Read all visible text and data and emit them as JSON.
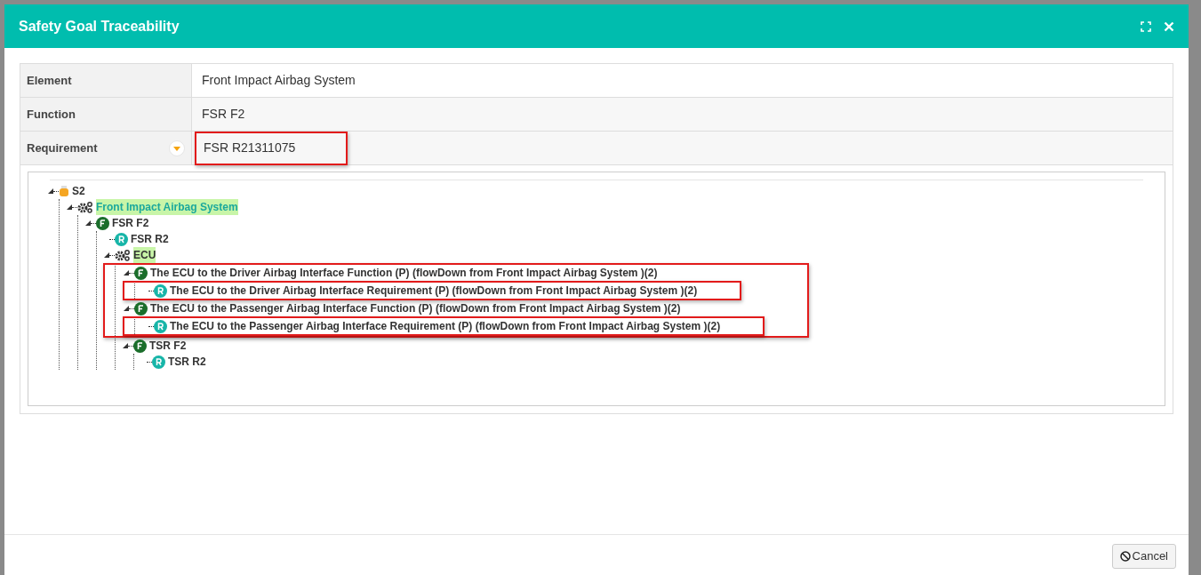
{
  "dialog": {
    "title": "Safety Goal Traceability"
  },
  "fields": [
    {
      "label": "Element",
      "value": "Front Impact Airbag System",
      "dropdown": false,
      "outlined": false
    },
    {
      "label": "Function",
      "value": "FSR F2",
      "dropdown": false,
      "outlined": false
    },
    {
      "label": "Requirement",
      "value": "FSR R21311075",
      "dropdown": true,
      "outlined": true
    }
  ],
  "tree": [
    {
      "kind": "goal",
      "label": "S2",
      "highlighted": false,
      "expanded": true,
      "children": [
        {
          "kind": "system",
          "label": "Front Impact Airbag System",
          "highlighted": true,
          "boxed": false,
          "expanded": true,
          "children": [
            {
              "kind": "function",
              "label": "FSR F2",
              "highlighted": false,
              "boxed": false,
              "expanded": true,
              "children": [
                {
                  "kind": "requirement",
                  "label": "FSR R2",
                  "highlighted": false,
                  "boxed": false,
                  "expanded": false
                },
                {
                  "kind": "system",
                  "label": "ECU",
                  "highlighted": true,
                  "boxed": false,
                  "expanded": true,
                  "children": [
                    {
                      "kind": "function",
                      "label": "The ECU to the Driver Airbag Interface Function (P) (flowDown from Front Impact Airbag System )(2)",
                      "highlighted": false,
                      "boxed": true,
                      "expanded": true,
                      "children": [
                        {
                          "kind": "requirement",
                          "label": "The ECU to the Driver Airbag Interface Requirement (P) (flowDown from Front Impact Airbag System )(2)",
                          "highlighted": false,
                          "boxed": true,
                          "expanded": false
                        }
                      ]
                    },
                    {
                      "kind": "function",
                      "label": "The ECU to the Passenger Airbag Interface Function (P) (flowDown from Front Impact Airbag System )(2)",
                      "highlighted": false,
                      "boxed": true,
                      "expanded": true,
                      "children": [
                        {
                          "kind": "requirement",
                          "label": "The ECU to the Passenger Airbag Interface Requirement (P) (flowDown from Front Impact Airbag System )(2)",
                          "highlighted": false,
                          "boxed": true,
                          "expanded": false
                        }
                      ]
                    },
                    {
                      "kind": "function",
                      "label": "TSR F2",
                      "highlighted": false,
                      "boxed": false,
                      "expanded": true,
                      "children": [
                        {
                          "kind": "requirement",
                          "label": "TSR R2",
                          "highlighted": false,
                          "boxed": false,
                          "expanded": false
                        }
                      ]
                    }
                  ]
                }
              ]
            }
          ]
        }
      ]
    }
  ],
  "footer": {
    "cancel": "Cancel"
  }
}
